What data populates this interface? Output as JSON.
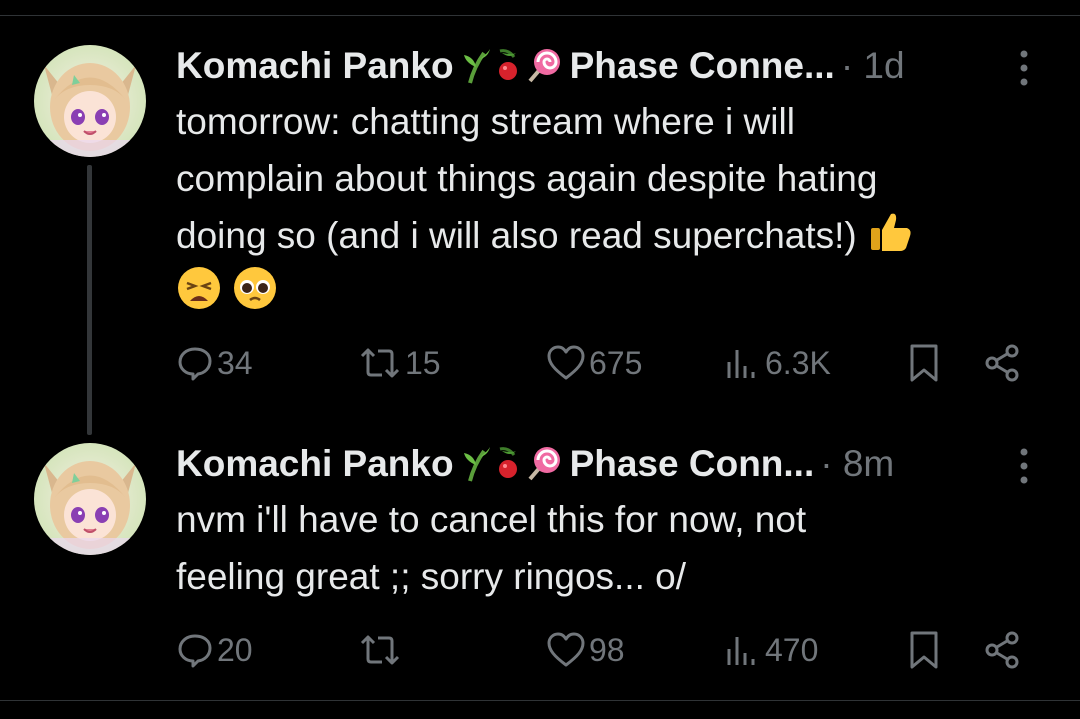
{
  "colors": {
    "background": "#000000",
    "text": "#e7e9ea",
    "muted": "#71767b",
    "divider": "#2f3336"
  },
  "tweets": [
    {
      "name": "Komachi Panko",
      "badges": [
        "bamboo-icon",
        "cherry-icon",
        "lollipop-icon"
      ],
      "org": "Phase Conne...",
      "time": "· 1d",
      "text_lines": [
        "tomorrow: chatting stream where i will",
        "complain about things again despite hating",
        "doing so (and i will also read superchats!)"
      ],
      "text_emojis": [
        "thumbs-up-emoji",
        "weary-face-emoji",
        "pleading-face-emoji"
      ],
      "replies": "34",
      "reposts": "15",
      "likes": "675",
      "views": "6.3K"
    },
    {
      "name": "Komachi Panko",
      "badges": [
        "bamboo-icon",
        "cherry-icon",
        "lollipop-icon"
      ],
      "org": "Phase Conn...",
      "time": "· 8m",
      "text_lines": [
        "nvm i'll have to cancel this for now, not",
        "feeling great ;; sorry ringos... o/"
      ],
      "text_emojis": [],
      "replies": "20",
      "reposts": "",
      "likes": "98",
      "views": "470"
    }
  ]
}
